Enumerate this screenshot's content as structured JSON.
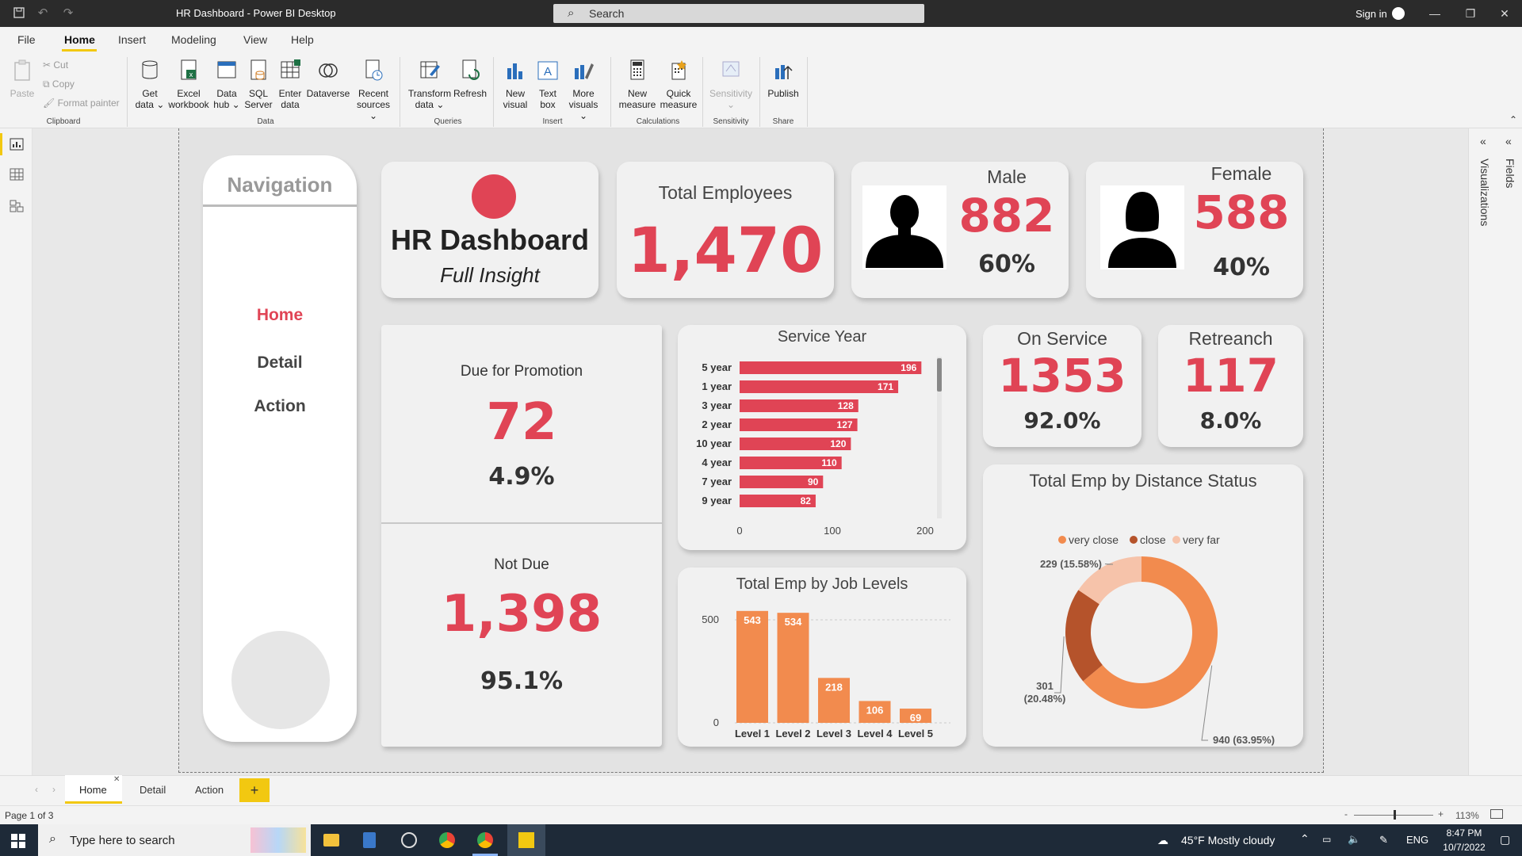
{
  "window": {
    "title": "HR Dashboard - Power BI Desktop",
    "search_placeholder": "Search",
    "signin": "Sign in"
  },
  "menu": [
    "File",
    "Home",
    "Insert",
    "Modeling",
    "View",
    "Help"
  ],
  "ribbon": {
    "clipboard": {
      "paste": "Paste",
      "cut": "Cut",
      "copy": "Copy",
      "format_painter": "Format painter",
      "group": "Clipboard"
    },
    "data": {
      "group": "Data",
      "buttons": [
        {
          "l1": "Get",
          "l2": "data ⌄"
        },
        {
          "l1": "Excel",
          "l2": "workbook"
        },
        {
          "l1": "Data",
          "l2": "hub ⌄"
        },
        {
          "l1": "SQL",
          "l2": "Server"
        },
        {
          "l1": "Enter",
          "l2": "data"
        },
        {
          "l1": "Dataverse",
          "l2": ""
        },
        {
          "l1": "Recent",
          "l2": "sources ⌄"
        }
      ]
    },
    "queries": {
      "group": "Queries",
      "buttons": [
        {
          "l1": "Transform",
          "l2": "data ⌄"
        },
        {
          "l1": "Refresh",
          "l2": ""
        }
      ]
    },
    "insert": {
      "group": "Insert",
      "buttons": [
        {
          "l1": "New",
          "l2": "visual"
        },
        {
          "l1": "Text",
          "l2": "box"
        },
        {
          "l1": "More",
          "l2": "visuals ⌄"
        }
      ]
    },
    "calculations": {
      "group": "Calculations",
      "buttons": [
        {
          "l1": "New",
          "l2": "measure"
        },
        {
          "l1": "Quick",
          "l2": "measure"
        }
      ]
    },
    "sensitivity": {
      "group": "Sensitivity",
      "label": "Sensitivity",
      "arrow": "⌄"
    },
    "share": {
      "group": "Share",
      "label": "Publish"
    }
  },
  "navigation": {
    "title": "Navigation",
    "items": [
      "Home",
      "Detail",
      "Action"
    ]
  },
  "header_card": {
    "title": "HR Dashboard",
    "subtitle": "Full Insight"
  },
  "total_employees": {
    "label": "Total Employees",
    "value": "1,470"
  },
  "male": {
    "label": "Male",
    "value": "882",
    "pct": "60%"
  },
  "female": {
    "label": "Female",
    "value": "588",
    "pct": "40%"
  },
  "promotion": {
    "due": {
      "label": "Due for Promotion",
      "value": "72",
      "pct": "4.9%"
    },
    "not_due": {
      "label": "Not Due",
      "value": "1,398",
      "pct": "95.1%"
    }
  },
  "on_service": {
    "label": "On Service",
    "value": "1353",
    "pct": "92.0%"
  },
  "retreanch": {
    "label": "Retreanch",
    "value": "117",
    "pct": "8.0%"
  },
  "chart_data": [
    {
      "type": "bar",
      "orientation": "horizontal",
      "title": "Service Year",
      "categories": [
        "5 year",
        "1 year",
        "3 year",
        "2 year",
        "10 year",
        "4 year",
        "7 year",
        "9 year"
      ],
      "values": [
        196,
        171,
        128,
        127,
        120,
        110,
        90,
        82
      ],
      "xlim": [
        0,
        200
      ],
      "xticks": [
        "0",
        "100",
        "200"
      ],
      "color": "#e04455"
    },
    {
      "type": "bar",
      "title": "Total Emp by Job Levels",
      "categories": [
        "Level 1",
        "Level 2",
        "Level 3",
        "Level 4",
        "Level 5"
      ],
      "values": [
        543,
        534,
        218,
        106,
        69
      ],
      "ylim": [
        0,
        600
      ],
      "yticks": [
        "0",
        "500"
      ],
      "color": "#f28b4e"
    },
    {
      "type": "pie",
      "donut": true,
      "title": "Total Emp by Distance Status",
      "legend_position": "top",
      "labels": [
        "very close",
        "close",
        "very far"
      ],
      "values": [
        940,
        301,
        229
      ],
      "data_labels": [
        "940 (63.95%)",
        "301 (20.48%)",
        "229 (15.58%)"
      ],
      "colors": [
        "#f28b4e",
        "#b5532b",
        "#f6c3aa"
      ]
    }
  ],
  "pages": [
    "Home",
    "Detail",
    "Action"
  ],
  "add_page": "+",
  "status": {
    "page": "Page 1 of 3",
    "zoom": "113%"
  },
  "taskbar": {
    "search": "Type here to search",
    "weather": "45°F  Mostly cloudy",
    "lang": "ENG",
    "time": "8:47 PM",
    "date": "10/7/2022"
  },
  "right_panes": [
    "Visualizations",
    "Fields"
  ],
  "colors": {
    "accent_red": "#e04455",
    "ribbon_underline": "#f2c811"
  }
}
